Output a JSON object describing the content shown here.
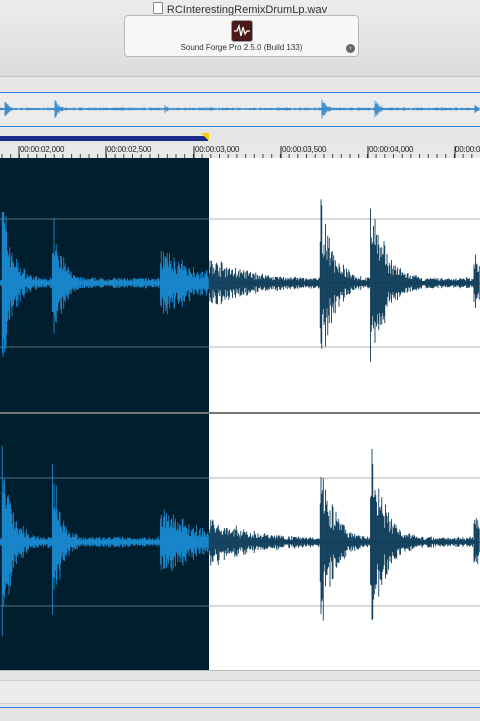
{
  "window": {
    "file_title": "RCInterestingRemixDrumLp.wav",
    "app_status": "Sound Forge Pro 2.5.0 (Build 133)"
  },
  "ruler": {
    "labels": [
      "00:00:02,000",
      "00:00:02,500",
      "00:00:03,000",
      "00:00:03,500",
      "00:00:04,000",
      "00:00:0"
    ]
  },
  "colors": {
    "selection_bg": "#001e2e",
    "selection_wave": "#1a8ad0",
    "unselected_wave": "#0d3c5a",
    "accent_blue": "#2e86d8",
    "selection_bar": "#1c2a8c",
    "marker_flag": "#f0d000"
  },
  "selection": {
    "end_time": "00:00:03,000"
  }
}
